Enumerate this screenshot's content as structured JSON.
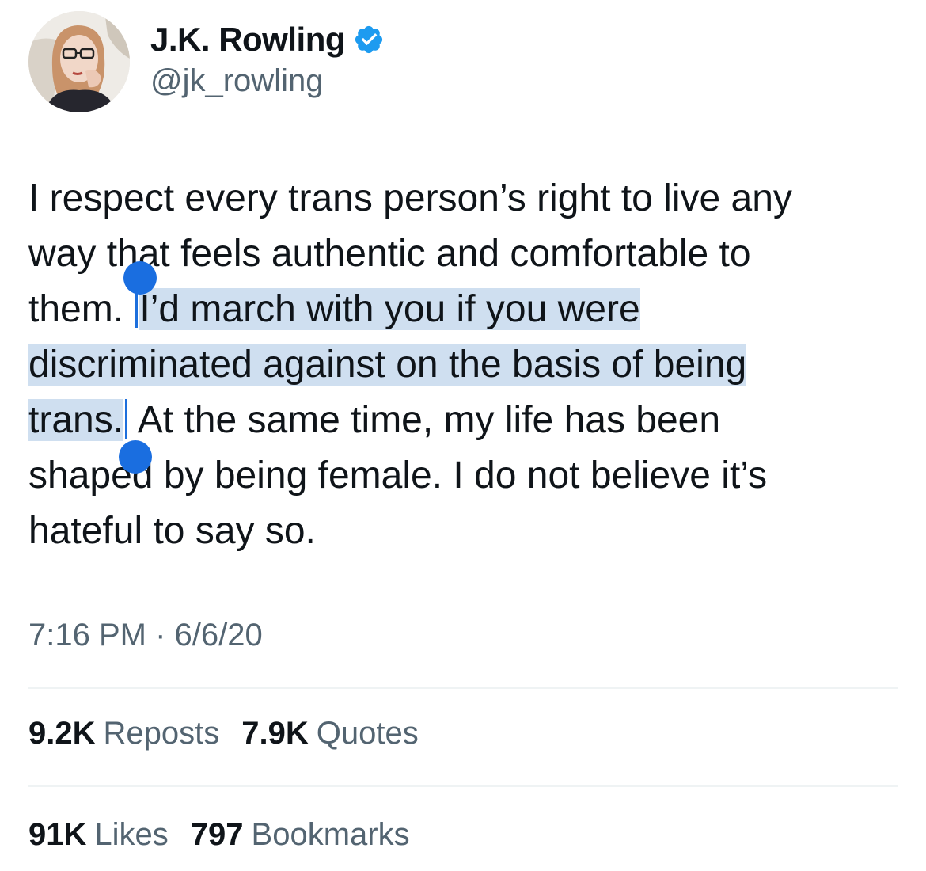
{
  "author": {
    "display_name": "J.K. Rowling",
    "handle": "@jk_rowling",
    "verified_icon": "verified-badge-icon",
    "verified_color": "#1d9bf0"
  },
  "tweet": {
    "lines": [
      {
        "before": "I respect every trans person’s right to live any"
      },
      {
        "before": "way that feels authentic and comfortable to"
      },
      {
        "before": "them. ",
        "selected": "I’d march with you if you were"
      },
      {
        "selected": "discriminated against on the basis of being"
      },
      {
        "selected": "trans.",
        "after": " At the same time, my life has been"
      },
      {
        "before": "shaped by being female. I do not believe it’s"
      },
      {
        "before": "hateful to say so."
      }
    ],
    "selection_color": "#cfdff0",
    "handle_color": "#1a6ee0"
  },
  "timestamp": "7:16 PM · 6/6/20",
  "stats": {
    "reposts_count": "9.2K",
    "reposts_label": "Reposts",
    "quotes_count": "7.9K",
    "quotes_label": "Quotes",
    "likes_count": "91K",
    "likes_label": "Likes",
    "bookmarks_count": "797",
    "bookmarks_label": "Bookmarks"
  }
}
